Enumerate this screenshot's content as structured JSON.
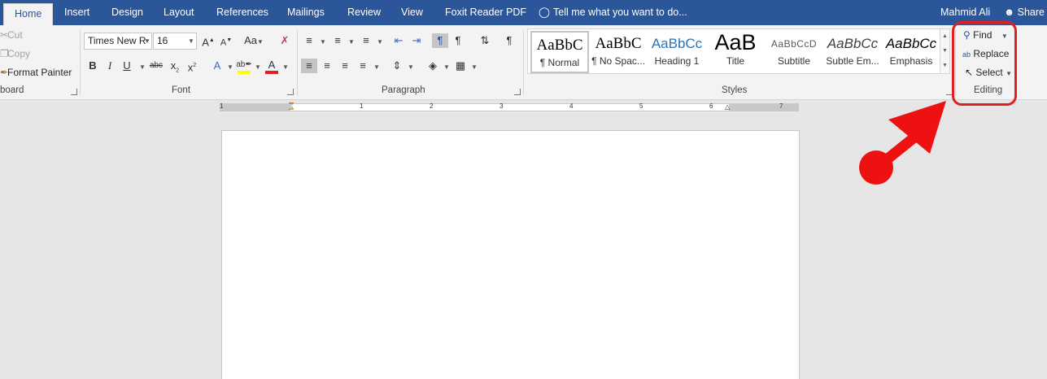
{
  "tabs": [
    "Home",
    "Insert",
    "Design",
    "Layout",
    "References",
    "Mailings",
    "Review",
    "View",
    "Foxit Reader PDF"
  ],
  "tell_me": "Tell me what you want to do...",
  "user_name": "Mahmid Ali",
  "share_label": "Share",
  "clipboard": {
    "label": "board",
    "cut": "Cut",
    "copy": "Copy",
    "format_painter": "Format Painter"
  },
  "font": {
    "label": "Font",
    "name": "Times New R",
    "size": "16"
  },
  "paragraph": {
    "label": "Paragraph"
  },
  "styles": {
    "label": "Styles",
    "items": [
      {
        "preview": "AaBbC",
        "name": "¶ Normal"
      },
      {
        "preview": "AaBbC",
        "name": "¶ No Spac..."
      },
      {
        "preview": "AaBbCc",
        "name": "Heading 1"
      },
      {
        "preview": "AaB",
        "name": "Title"
      },
      {
        "preview": "AaBbCcD",
        "name": "Subtitle"
      },
      {
        "preview": "AaBbCc",
        "name": "Subtle Em..."
      },
      {
        "preview": "AaBbCc",
        "name": "Emphasis"
      }
    ]
  },
  "editing": {
    "label": "Editing",
    "find": "Find",
    "replace": "Replace",
    "select": "Select"
  },
  "ruler_numbers": [
    "1",
    "1",
    "2",
    "3",
    "4",
    "5",
    "6",
    "7"
  ],
  "colors": {
    "title_bar": "#2b579a",
    "ribbon": "#f3f3f3",
    "annotation_red": "#e02020",
    "font_color_bar": "#e02020",
    "highlight_bar": "#ffff00"
  }
}
